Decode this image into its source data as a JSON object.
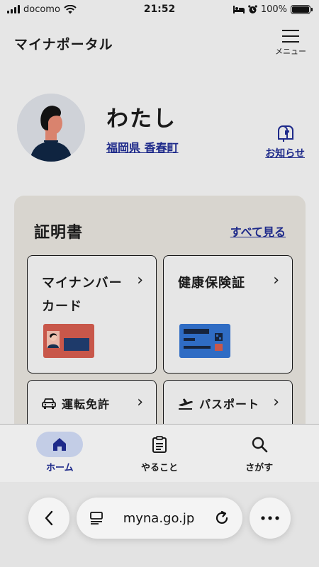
{
  "status_bar": {
    "carrier": "docomo",
    "time": "21:52",
    "battery": "100%",
    "battery_level": 1.0
  },
  "header": {
    "title": "マイナポータル",
    "menu_label": "メニュー"
  },
  "profile": {
    "name": "わたし",
    "region": "福岡県 香春町",
    "notice_label": "お知らせ"
  },
  "certificates": {
    "title": "証明書",
    "see_all": "すべて見る",
    "cards": [
      {
        "line1": "マイナンバー",
        "line2": "カード"
      },
      {
        "line1": "健康保険証"
      },
      {
        "line1": "運転免許"
      },
      {
        "line1": "パスポート"
      }
    ]
  },
  "nav": {
    "items": [
      {
        "label": "ホーム",
        "icon": "home-icon",
        "active": true
      },
      {
        "label": "やること",
        "icon": "clipboard-icon",
        "active": false
      },
      {
        "label": "さがす",
        "icon": "search-icon",
        "active": false
      }
    ]
  },
  "browser": {
    "url": "myna.go.jp"
  },
  "colors": {
    "background": "#e6e6e6",
    "panel": "#d8d5cf",
    "link": "#1e2a8a",
    "nav_active_bg": "#c3cde6",
    "mynumber_card": "#c8574a",
    "insurance_card": "#2f6cc4"
  }
}
